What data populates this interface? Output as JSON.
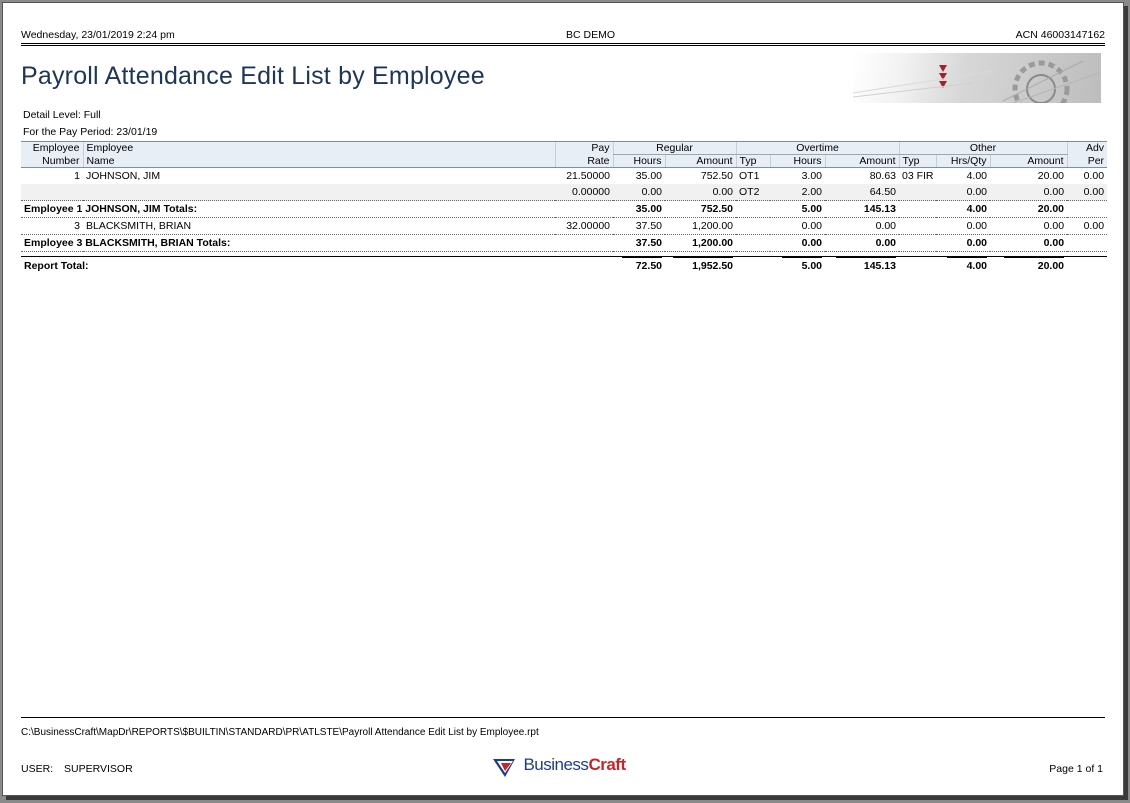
{
  "header": {
    "datetime": "Wednesday, 23/01/2019  2:24 pm",
    "company": "BC DEMO",
    "acn": "ACN 46003147162"
  },
  "title": "Payroll Attendance Edit List by Employee",
  "meta": {
    "detail_level": "Detail Level: Full",
    "pay_period": "For the Pay Period:  23/01/19"
  },
  "columns": {
    "emp_number_1": "Employee",
    "emp_number_2": "Number",
    "emp_name_1": "Employee",
    "emp_name_2": "Name",
    "pay_1": "Pay",
    "pay_2": "Rate",
    "regular": "Regular",
    "overtime": "Overtime",
    "other": "Other",
    "adv_1": "Adv",
    "adv_2": "Per",
    "hours": "Hours",
    "amount": "Amount",
    "typ": "Typ",
    "hrs_qty": "Hrs/Qty"
  },
  "rows": [
    {
      "num": "1",
      "name": "JOHNSON, JIM",
      "rate": "21.50000",
      "reg_hours": "35.00",
      "reg_amount": "752.50",
      "ot_typ": "OT1",
      "ot_hours": "3.00",
      "ot_amount": "80.63",
      "oth_typ": "03 FIR",
      "oth_qty": "4.00",
      "oth_amount": "20.00",
      "adv": "0.00"
    },
    {
      "num": "",
      "name": "",
      "rate": "0.00000",
      "reg_hours": "0.00",
      "reg_amount": "0.00",
      "ot_typ": "OT2",
      "ot_hours": "2.00",
      "ot_amount": "64.50",
      "oth_typ": "",
      "oth_qty": "0.00",
      "oth_amount": "0.00",
      "adv": "0.00"
    }
  ],
  "totals1": {
    "label": "Employee  1  JOHNSON, JIM Totals:",
    "reg_hours": "35.00",
    "reg_amount": "752.50",
    "ot_hours": "5.00",
    "ot_amount": "145.13",
    "oth_qty": "4.00",
    "oth_amount": "20.00"
  },
  "row3": {
    "num": "3",
    "name": "BLACKSMITH, BRIAN",
    "rate": "32.00000",
    "reg_hours": "37.50",
    "reg_amount": "1,200.00",
    "ot_hours": "0.00",
    "ot_amount": "0.00",
    "oth_qty": "0.00",
    "oth_amount": "0.00",
    "adv": "0.00"
  },
  "totals3": {
    "label": "Employee  3  BLACKSMITH, BRIAN Totals:",
    "reg_hours": "37.50",
    "reg_amount": "1,200.00",
    "ot_hours": "0.00",
    "ot_amount": "0.00",
    "oth_qty": "0.00",
    "oth_amount": "0.00"
  },
  "report_total": {
    "label": "Report Total:",
    "reg_hours": "72.50",
    "reg_amount": "1,952.50",
    "ot_hours": "5.00",
    "ot_amount": "145.13",
    "oth_qty": "4.00",
    "oth_amount": "20.00"
  },
  "footer": {
    "path": "C:\\BusinessCraft\\MapDr\\REPORTS\\$BUILTIN\\STANDARD\\PR\\ATLSTE\\Payroll Attendance Edit List by Employee.rpt",
    "user_label": "USER:",
    "user": "SUPERVISOR",
    "brand_a": "Business",
    "brand_b": "Craft",
    "page": "Page 1 of 1"
  },
  "colors": {
    "title": "#1d3557",
    "brand_red": "#c0262c",
    "brand_blue": "#1f3c88"
  }
}
